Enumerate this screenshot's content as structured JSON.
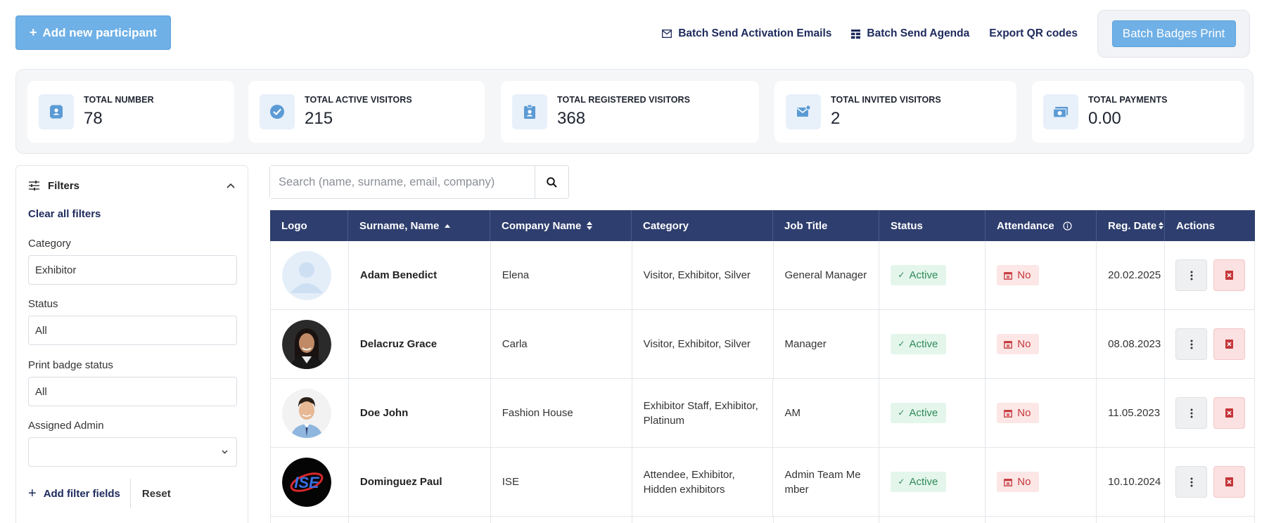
{
  "toolbar": {
    "add_label": "Add new participant",
    "activation_label": "Batch Send Activation Emails",
    "agenda_label": "Batch Send Agenda",
    "export_qr_label": "Export QR codes",
    "badges_label": "Batch Badges Print"
  },
  "stats": [
    {
      "label": "TOTAL NUMBER",
      "value": "78",
      "icon": "contact-card-icon"
    },
    {
      "label": "TOTAL ACTIVE VISITORS",
      "value": "215",
      "icon": "check-circle-icon"
    },
    {
      "label": "TOTAL REGISTERED VISITORS",
      "value": "368",
      "icon": "id-badge-icon"
    },
    {
      "label": "TOTAL INVITED VISITORS",
      "value": "2",
      "icon": "envelope-icon"
    },
    {
      "label": "TOTAL PAYMENTS",
      "value": "0.00",
      "icon": "money-icon"
    }
  ],
  "filters": {
    "title": "Filters",
    "clear_all": "Clear all filters",
    "category_label": "Category",
    "category_value": "Exhibitor",
    "status_label": "Status",
    "status_value": "All",
    "print_label": "Print badge status",
    "print_value": "All",
    "admin_label": "Assigned Admin",
    "admin_value": "",
    "add_fields": "Add filter fields",
    "reset": "Reset"
  },
  "search": {
    "placeholder": "Search (name, surname, email, company)"
  },
  "table": {
    "headers": {
      "logo": "Logo",
      "name": "Surname, Name",
      "company": "Company Name",
      "category": "Category",
      "job": "Job Title",
      "status": "Status",
      "attendance": "Attendance",
      "reg_date": "Reg. Date",
      "actions": "Actions"
    },
    "rows": [
      {
        "name": "Adam Benedict",
        "company": "Elena",
        "category": "Visitor, Exhibitor, Silver",
        "job": "General Manager",
        "status": "Active",
        "attendance": "No",
        "reg_date": "20.02.2025",
        "avatar": "placeholder-avatar-icon"
      },
      {
        "name": "Delacruz Grace",
        "company": "Carla",
        "category": "Visitor, Exhibitor, Silver",
        "job": "Manager",
        "status": "Active",
        "attendance": "No",
        "reg_date": "08.08.2023",
        "avatar": "woman-photo"
      },
      {
        "name": "Doe John",
        "company": "Fashion House",
        "category": "Exhibitor Staff, Exhibitor, Platinum",
        "job": "AM",
        "status": "Active",
        "attendance": "No",
        "reg_date": "11.05.2023",
        "avatar": "man-photo"
      },
      {
        "name": "Dominguez Paul",
        "company": "ISE",
        "category": "Attendee, Exhibitor, Hidden exhibitors",
        "job": "Admin Team Me mber",
        "status": "Active",
        "attendance": "No",
        "reg_date": "10.10.2024",
        "avatar": "ise-logo",
        "avatar_text": "ISE"
      }
    ]
  },
  "colors": {
    "primary": "#6fb0e6",
    "header_bg": "#2e3e6e",
    "active_bg": "#e4f6ec",
    "active_fg": "#2f8a58",
    "no_bg": "#fce6e6",
    "no_fg": "#c4363a"
  }
}
